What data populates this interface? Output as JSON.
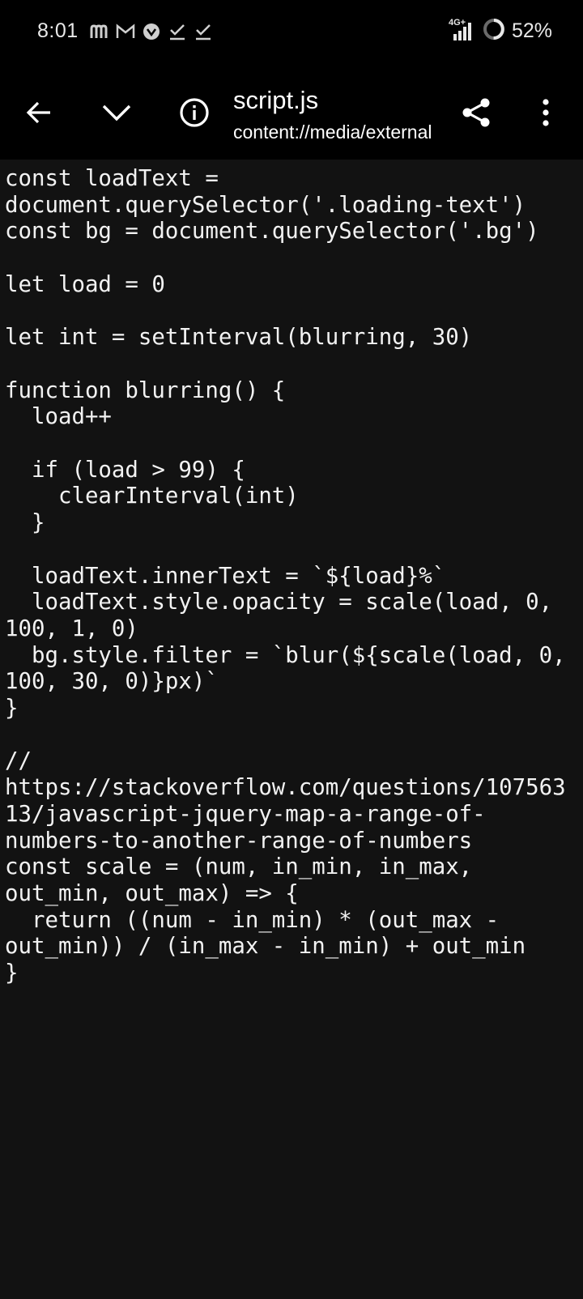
{
  "status_bar": {
    "time": "8:01",
    "notification_icons": [
      "m-logo-icon",
      "gmail-icon",
      "app-icon",
      "check-icon",
      "check-icon"
    ],
    "network": "4G+",
    "battery_percent": "52%"
  },
  "toolbar": {
    "title": "script.js",
    "subtitle": "content://media/external",
    "icons": [
      "back-arrow-icon",
      "chevron-down-icon",
      "info-icon",
      "share-icon",
      "more-vert-icon"
    ]
  },
  "code": {
    "lines": [
      "const loadText =",
      "document.querySelector('.loading-text')",
      "const bg = document.querySelector('.bg')",
      "",
      "let load = 0",
      "",
      "let int = setInterval(blurring, 30)",
      "",
      "function blurring() {",
      "  load++",
      "",
      "  if (load > 99) {",
      "    clearInterval(int)",
      "  }",
      "",
      "  loadText.innerText = `${load}%`",
      "  loadText.style.opacity = scale(load, 0,",
      "100, 1, 0)",
      "  bg.style.filter = `blur(${scale(load, 0,",
      "100, 30, 0)}px)`",
      "}",
      "",
      "//",
      "https://stackoverflow.com/questions/107563",
      "13/javascript-jquery-map-a-range-of-",
      "numbers-to-another-range-of-numbers",
      "const scale = (num, in_min, in_max,",
      "out_min, out_max) => {",
      "  return ((num - in_min) * (out_max -",
      "out_min)) / (in_max - in_min) + out_min",
      "}"
    ]
  }
}
